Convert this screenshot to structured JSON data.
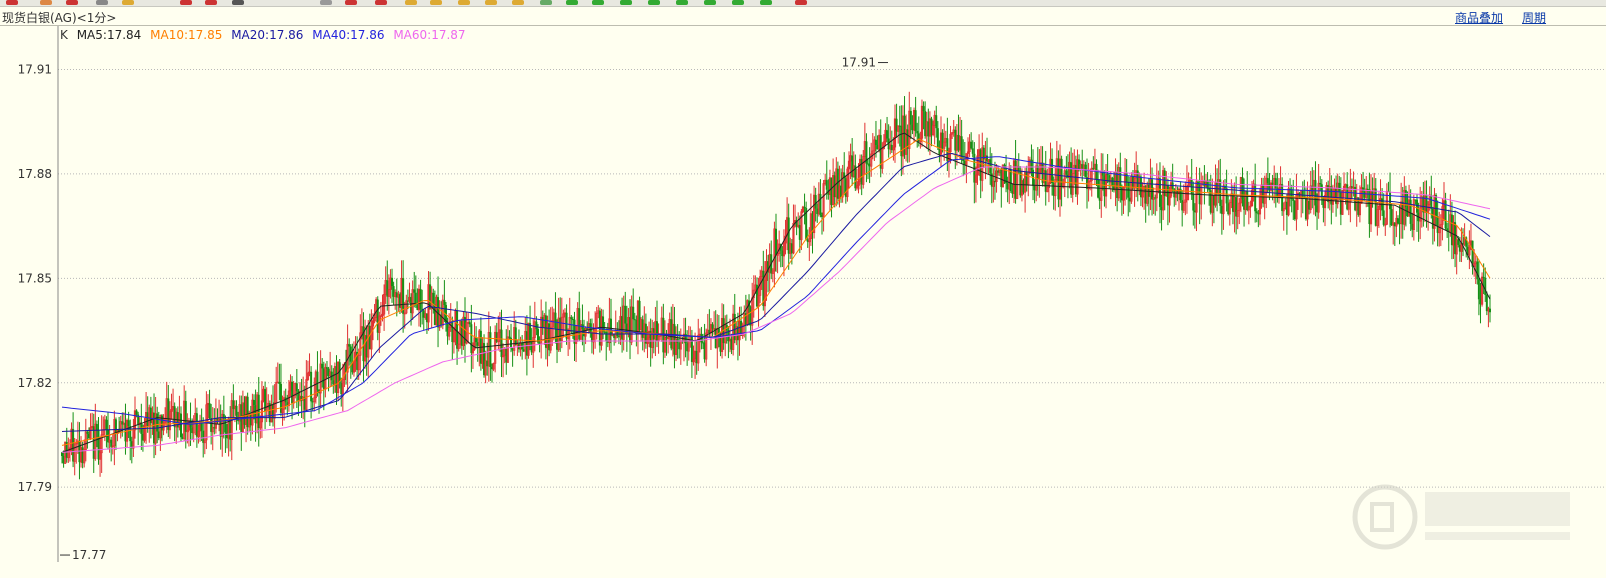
{
  "window": {
    "title": "现货白银(AG)<1分>",
    "links": [
      "商品叠加",
      "周期"
    ]
  },
  "legend": [
    {
      "label": "K",
      "color": "#333333"
    },
    {
      "label": "MA5:17.84",
      "color": "#222222"
    },
    {
      "label": "MA10:17.85",
      "color": "#ff7f00"
    },
    {
      "label": "MA20:17.86",
      "color": "#1a1aa0"
    },
    {
      "label": "MA40:17.86",
      "color": "#2222dd"
    },
    {
      "label": "MA60:17.87",
      "color": "#ee66ee"
    }
  ],
  "colors": {
    "up": "#e03030",
    "down": "#159015",
    "grid": "#b8b8b8",
    "background": "#fffff0"
  },
  "chart_data": {
    "type": "candlestick",
    "interval": "1分",
    "ylim": [
      17.77,
      17.915
    ],
    "yticks": [
      17.79,
      17.82,
      17.85,
      17.88,
      17.91
    ],
    "annotations": [
      {
        "label": "17.91",
        "kind": "high"
      },
      {
        "label": "17.77",
        "kind": "low"
      }
    ],
    "price_path": [
      [
        0,
        17.8
      ],
      [
        30,
        17.805
      ],
      [
        70,
        17.81
      ],
      [
        100,
        17.808
      ],
      [
        140,
        17.815
      ],
      [
        175,
        17.822
      ],
      [
        195,
        17.835
      ],
      [
        205,
        17.848
      ],
      [
        215,
        17.845
      ],
      [
        235,
        17.842
      ],
      [
        250,
        17.835
      ],
      [
        265,
        17.828
      ],
      [
        290,
        17.832
      ],
      [
        315,
        17.835
      ],
      [
        340,
        17.836
      ],
      [
        365,
        17.838
      ],
      [
        375,
        17.833
      ],
      [
        400,
        17.831
      ],
      [
        420,
        17.833
      ],
      [
        440,
        17.845
      ],
      [
        450,
        17.86
      ],
      [
        470,
        17.866
      ],
      [
        490,
        17.878
      ],
      [
        525,
        17.89
      ],
      [
        545,
        17.895
      ],
      [
        560,
        17.888
      ],
      [
        575,
        17.883
      ],
      [
        600,
        17.878
      ],
      [
        640,
        17.879
      ],
      [
        680,
        17.876
      ],
      [
        720,
        17.874
      ],
      [
        760,
        17.873
      ],
      [
        800,
        17.872
      ],
      [
        840,
        17.87
      ],
      [
        870,
        17.868
      ],
      [
        880,
        17.86
      ],
      [
        890,
        17.855
      ],
      [
        895,
        17.845
      ],
      [
        900,
        17.843
      ]
    ],
    "ma_series": [
      {
        "name": "MA5",
        "color": "#222222",
        "points": [
          [
            0,
            17.8
          ],
          [
            60,
            17.81
          ],
          [
            100,
            17.808
          ],
          [
            140,
            17.815
          ],
          [
            175,
            17.823
          ],
          [
            200,
            17.842
          ],
          [
            230,
            17.843
          ],
          [
            260,
            17.83
          ],
          [
            300,
            17.832
          ],
          [
            340,
            17.836
          ],
          [
            375,
            17.834
          ],
          [
            400,
            17.832
          ],
          [
            430,
            17.84
          ],
          [
            460,
            17.865
          ],
          [
            490,
            17.878
          ],
          [
            530,
            17.892
          ],
          [
            550,
            17.886
          ],
          [
            600,
            17.877
          ],
          [
            650,
            17.876
          ],
          [
            720,
            17.874
          ],
          [
            780,
            17.873
          ],
          [
            840,
            17.871
          ],
          [
            880,
            17.862
          ],
          [
            900,
            17.844
          ]
        ]
      },
      {
        "name": "MA10",
        "color": "#ff7f00",
        "points": [
          [
            0,
            17.802
          ],
          [
            60,
            17.808
          ],
          [
            100,
            17.809
          ],
          [
            140,
            17.813
          ],
          [
            175,
            17.82
          ],
          [
            200,
            17.838
          ],
          [
            230,
            17.844
          ],
          [
            260,
            17.833
          ],
          [
            300,
            17.832
          ],
          [
            340,
            17.835
          ],
          [
            380,
            17.834
          ],
          [
            410,
            17.833
          ],
          [
            440,
            17.842
          ],
          [
            470,
            17.862
          ],
          [
            500,
            17.878
          ],
          [
            540,
            17.89
          ],
          [
            570,
            17.884
          ],
          [
            620,
            17.878
          ],
          [
            680,
            17.876
          ],
          [
            740,
            17.874
          ],
          [
            800,
            17.873
          ],
          [
            850,
            17.871
          ],
          [
            880,
            17.865
          ],
          [
            900,
            17.85
          ]
        ]
      },
      {
        "name": "MA20",
        "color": "#1a1aa0",
        "points": [
          [
            0,
            17.806
          ],
          [
            60,
            17.807
          ],
          [
            100,
            17.81
          ],
          [
            140,
            17.81
          ],
          [
            175,
            17.815
          ],
          [
            200,
            17.83
          ],
          [
            230,
            17.842
          ],
          [
            260,
            17.84
          ],
          [
            300,
            17.836
          ],
          [
            340,
            17.834
          ],
          [
            380,
            17.834
          ],
          [
            410,
            17.833
          ],
          [
            440,
            17.838
          ],
          [
            470,
            17.852
          ],
          [
            500,
            17.868
          ],
          [
            530,
            17.882
          ],
          [
            560,
            17.886
          ],
          [
            600,
            17.881
          ],
          [
            660,
            17.878
          ],
          [
            720,
            17.876
          ],
          [
            780,
            17.874
          ],
          [
            840,
            17.872
          ],
          [
            880,
            17.869
          ],
          [
            900,
            17.862
          ]
        ]
      },
      {
        "name": "MA40",
        "color": "#2222dd",
        "points": [
          [
            0,
            17.813
          ],
          [
            40,
            17.811
          ],
          [
            80,
            17.808
          ],
          [
            120,
            17.81
          ],
          [
            160,
            17.812
          ],
          [
            190,
            17.82
          ],
          [
            220,
            17.834
          ],
          [
            250,
            17.838
          ],
          [
            290,
            17.839
          ],
          [
            330,
            17.836
          ],
          [
            370,
            17.834
          ],
          [
            410,
            17.833
          ],
          [
            440,
            17.835
          ],
          [
            470,
            17.845
          ],
          [
            500,
            17.86
          ],
          [
            530,
            17.874
          ],
          [
            560,
            17.884
          ],
          [
            590,
            17.885
          ],
          [
            630,
            17.882
          ],
          [
            680,
            17.879
          ],
          [
            740,
            17.876
          ],
          [
            800,
            17.875
          ],
          [
            860,
            17.873
          ],
          [
            900,
            17.867
          ]
        ]
      },
      {
        "name": "MA60",
        "color": "#ee66ee",
        "points": [
          [
            0,
            17.8
          ],
          [
            60,
            17.802
          ],
          [
            100,
            17.805
          ],
          [
            140,
            17.807
          ],
          [
            180,
            17.812
          ],
          [
            210,
            17.82
          ],
          [
            240,
            17.826
          ],
          [
            280,
            17.83
          ],
          [
            320,
            17.832
          ],
          [
            360,
            17.832
          ],
          [
            400,
            17.832
          ],
          [
            430,
            17.834
          ],
          [
            460,
            17.84
          ],
          [
            490,
            17.852
          ],
          [
            520,
            17.866
          ],
          [
            550,
            17.876
          ],
          [
            580,
            17.882
          ],
          [
            620,
            17.882
          ],
          [
            680,
            17.88
          ],
          [
            740,
            17.877
          ],
          [
            800,
            17.876
          ],
          [
            860,
            17.874
          ],
          [
            900,
            17.87
          ]
        ]
      }
    ]
  }
}
